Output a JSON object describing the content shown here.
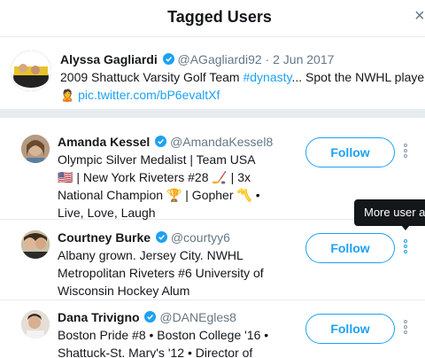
{
  "header": {
    "title": "Tagged Users",
    "close_label": "×"
  },
  "tweet": {
    "author_name": "Alyssa Gagliardi",
    "author_handle": "@AGagliardi92",
    "separator": "·",
    "date": "2 Jun 2017",
    "text_prefix": "2009 Shattuck Varsity Golf Team ",
    "hashtag": "#dynasty",
    "text_suffix": "... Spot the NWHL players",
    "link": "pic.twitter.com/bP6evaltXf"
  },
  "users": [
    {
      "name": "Amanda Kessel",
      "handle": "@AmandaKessel8",
      "bio": "Olympic Silver Medalist | Team USA 🇺🇸 | New York Riveters #28 🏒 | 3x National Champion 🏆 | Gopher 〽️ • Live, Love, Laugh",
      "follow_label": "Follow"
    },
    {
      "name": "Courtney Burke",
      "handle": "@courtyy6",
      "bio": "Albany grown. Jersey City. NWHL Metropolitan Riveters #6 University of Wisconsin Hockey Alum",
      "follow_label": "Follow"
    },
    {
      "name": "Dana Trivigno",
      "handle": "@DANEgles8",
      "bio": "Boston Pride #8 • Boston College '16 • Shattuck-St. Mary's '12 • Director of",
      "follow_label": "Follow"
    }
  ],
  "tooltip": {
    "text": "More user actions"
  },
  "colors": {
    "accent": "#1da1f2",
    "text": "#14171a",
    "muted": "#657786",
    "border": "#e6ecf0"
  }
}
